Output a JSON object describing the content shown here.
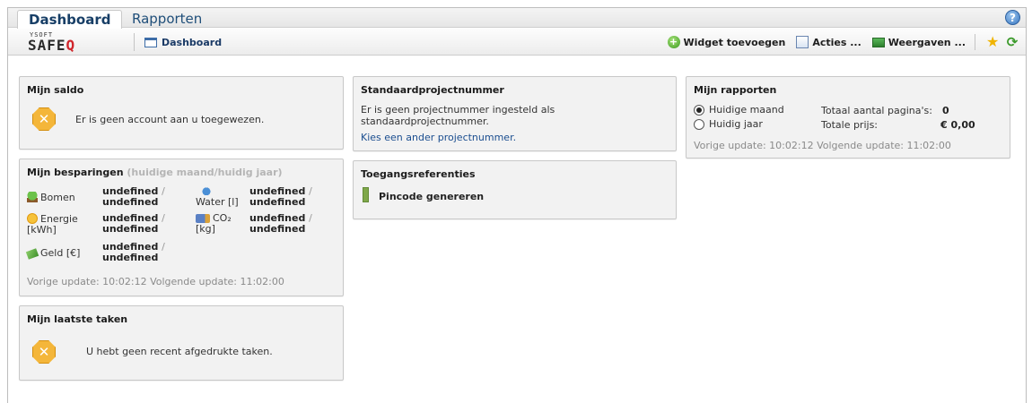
{
  "tabs": [
    {
      "label": "Dashboard",
      "active": true
    },
    {
      "label": "Rapporten",
      "active": false
    }
  ],
  "help_icon": "?",
  "logo": {
    "small": "YSOFT",
    "big_main": "SAFE",
    "big_q": "Q"
  },
  "breadcrumb": {
    "label": "Dashboard",
    "icon": "window-icon"
  },
  "toolbar": {
    "add_widget": "Widget toevoegen",
    "actions": "Acties ...",
    "views": "Weergaven ..."
  },
  "saldo": {
    "title": "Mijn saldo",
    "message": "Er is geen account aan u toegewezen."
  },
  "savings": {
    "title": "Mijn besparingen",
    "subtitle": "(huidige maand/huidig jaar)",
    "items": [
      {
        "label": "Bomen",
        "value_a": "undefined",
        "slash": "/",
        "value_b": "undefined",
        "icon": "tree-icon"
      },
      {
        "label": "Water [l]",
        "value_a": "undefined",
        "slash": "/",
        "value_b": "undefined",
        "icon": "water-icon"
      },
      {
        "label": "Energie",
        "label2": "[kWh]",
        "value_a": "undefined",
        "slash": "/",
        "value_b": "undefined",
        "icon": "energy-icon"
      },
      {
        "label": "CO₂",
        "label2": "[kg]",
        "value_a": "undefined",
        "slash": "/",
        "value_b": "undefined",
        "icon": "truck-icon"
      },
      {
        "label": "Geld [€]",
        "value_a": "undefined",
        "slash": "/",
        "value_b": "undefined",
        "icon": "money-icon"
      }
    ],
    "footer": "Vorige update: 10:02:12  Volgende update: 11:02:00"
  },
  "tasks": {
    "title": "Mijn laatste taken",
    "message": "U hebt geen recent afgedrukte taken."
  },
  "project": {
    "title": "Standaardprojectnummer",
    "line1": "Er is geen projectnummer ingesteld als",
    "line2": "standaardprojectnummer.",
    "link": "Kies een ander projectnummer."
  },
  "access": {
    "title": "Toegangsreferenties",
    "pin_label": "Pincode genereren"
  },
  "reports": {
    "title": "Mijn rapporten",
    "option_month": "Huidige maand",
    "option_year": "Huidig jaar",
    "selected": "month",
    "pages_label": "Totaal aantal pagina's:",
    "pages_value": "0",
    "price_label": "Totale prijs:",
    "price_value": "€ 0,00",
    "footer": "Vorige update: 10:02:12  Volgende update: 11:02:00"
  },
  "colors": {
    "accent": "#1a4d8f",
    "warning": "#f4b63a",
    "panel_bg": "#f2f2f2"
  }
}
